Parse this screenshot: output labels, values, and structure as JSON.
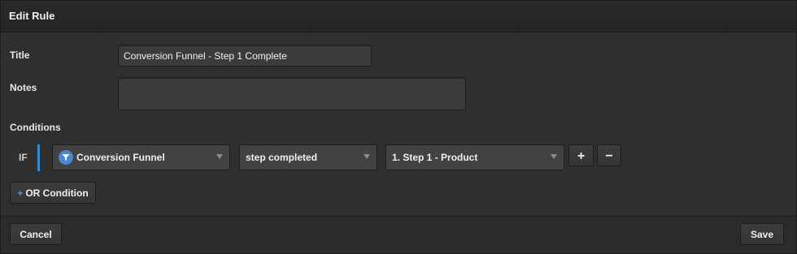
{
  "dialog": {
    "title": "Edit Rule"
  },
  "form": {
    "title_label": "Title",
    "title_value": "Conversion Funnel - Step 1 Complete",
    "notes_label": "Notes",
    "notes_value": "",
    "conditions_label": "Conditions"
  },
  "condition": {
    "operator": "IF",
    "source": "Conversion Funnel",
    "source_icon": "funnel-icon",
    "event": "step completed",
    "value": "1. Step 1 - Product",
    "add_label": "+",
    "remove_label": "−"
  },
  "actions": {
    "or_condition_plus": "+",
    "or_condition_label": "OR Condition",
    "cancel_label": "Cancel",
    "save_label": "Save"
  },
  "colors": {
    "accent": "#2f8bd6",
    "icon_bg": "#4c86d0"
  }
}
